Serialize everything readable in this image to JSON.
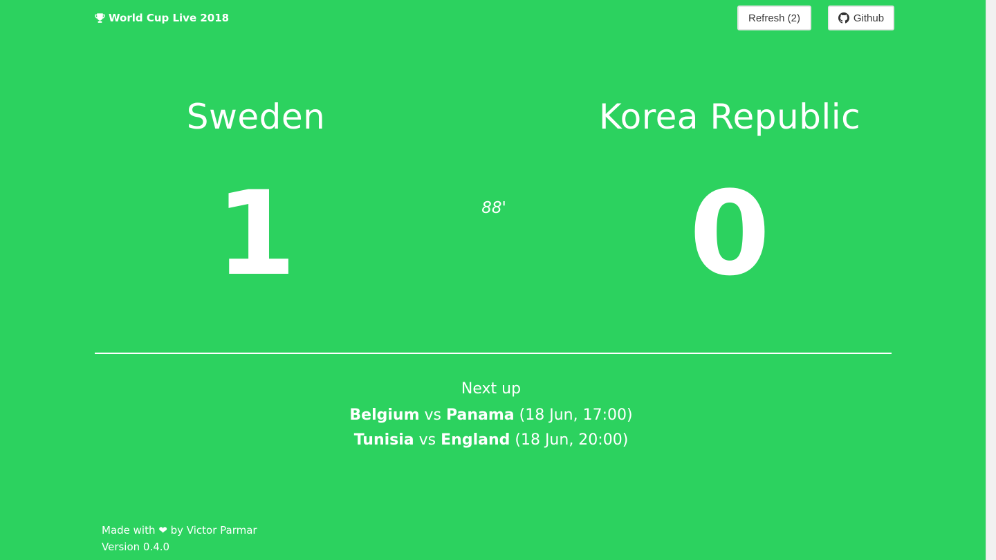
{
  "header": {
    "brand": "World Cup Live 2018",
    "refresh_label": "Refresh (2)",
    "github_label": "Github"
  },
  "match": {
    "home_team": "Sweden",
    "away_team": "Korea Republic",
    "home_score": "1",
    "away_score": "0",
    "minute": "88'"
  },
  "next_up": {
    "title": "Next up",
    "matches": [
      {
        "home": "Belgium",
        "vs": "vs",
        "away": "Panama",
        "time": "(18 Jun, 17:00)"
      },
      {
        "home": "Tunisia",
        "vs": "vs",
        "away": "England",
        "time": "(18 Jun, 20:00)"
      }
    ]
  },
  "footer": {
    "made_with": "Made with",
    "heart": "❤",
    "by": "by Victor Parmar",
    "version": "Version 0.4.0"
  },
  "colors": {
    "background": "#2cd25f",
    "text": "#ffffff"
  },
  "icons": {
    "brand": "trophy-icon",
    "github": "github-icon",
    "heart": "heart-icon"
  }
}
